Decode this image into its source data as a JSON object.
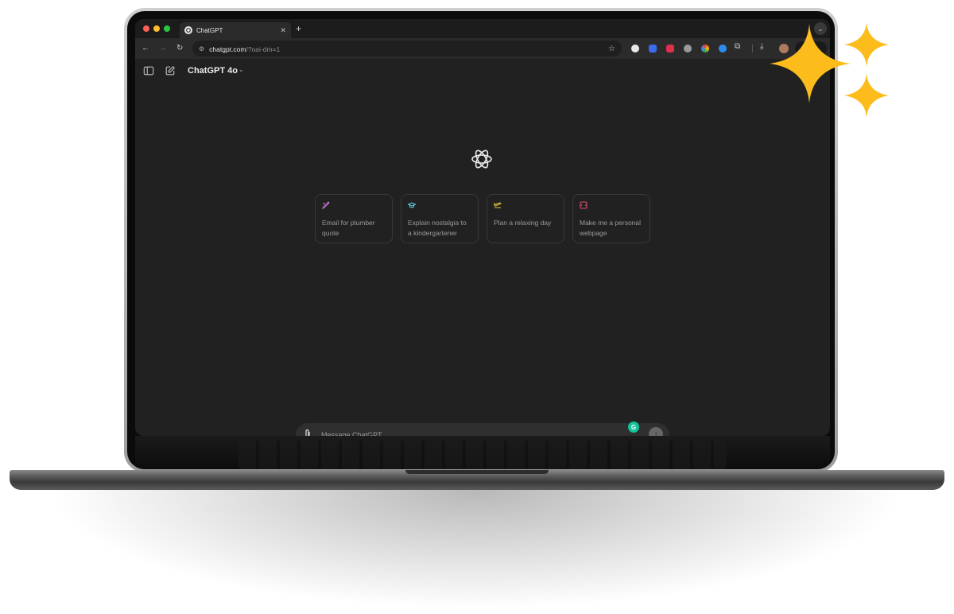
{
  "browser": {
    "tab_title": "ChatGPT",
    "tab_close_icon": "close-icon",
    "new_tab_label": "+",
    "url_host": "chatgpt.com",
    "url_rest": "/?oai-dm=1",
    "colors": {
      "dot_red": "#ff5f57",
      "dot_yellow": "#febc2e",
      "dot_green": "#28c840"
    }
  },
  "header": {
    "model_label": "ChatGPT 4o",
    "icons": [
      "sidebar-toggle-icon",
      "new-chat-icon",
      "chevron-down-icon"
    ]
  },
  "suggestions": [
    {
      "label": "Email for plumber quote",
      "icon": "pen-icon",
      "color": "#c77ddf"
    },
    {
      "label": "Explain nostalgia to a kindergartener",
      "icon": "graduation-cap-icon",
      "color": "#5ccfe6"
    },
    {
      "label": "Plan a relaxing day",
      "icon": "plane-icon",
      "color": "#e2c541"
    },
    {
      "label": "Make me a personal webpage",
      "icon": "code-icon",
      "color": "#e2506e"
    }
  ],
  "composer": {
    "placeholder": "Message ChatGPT",
    "attach_icon": "paperclip-icon",
    "send_icon": "arrow-up-icon",
    "grammarly_label": "G"
  },
  "decor": {
    "sparkle_color": "#fbbc1c"
  }
}
